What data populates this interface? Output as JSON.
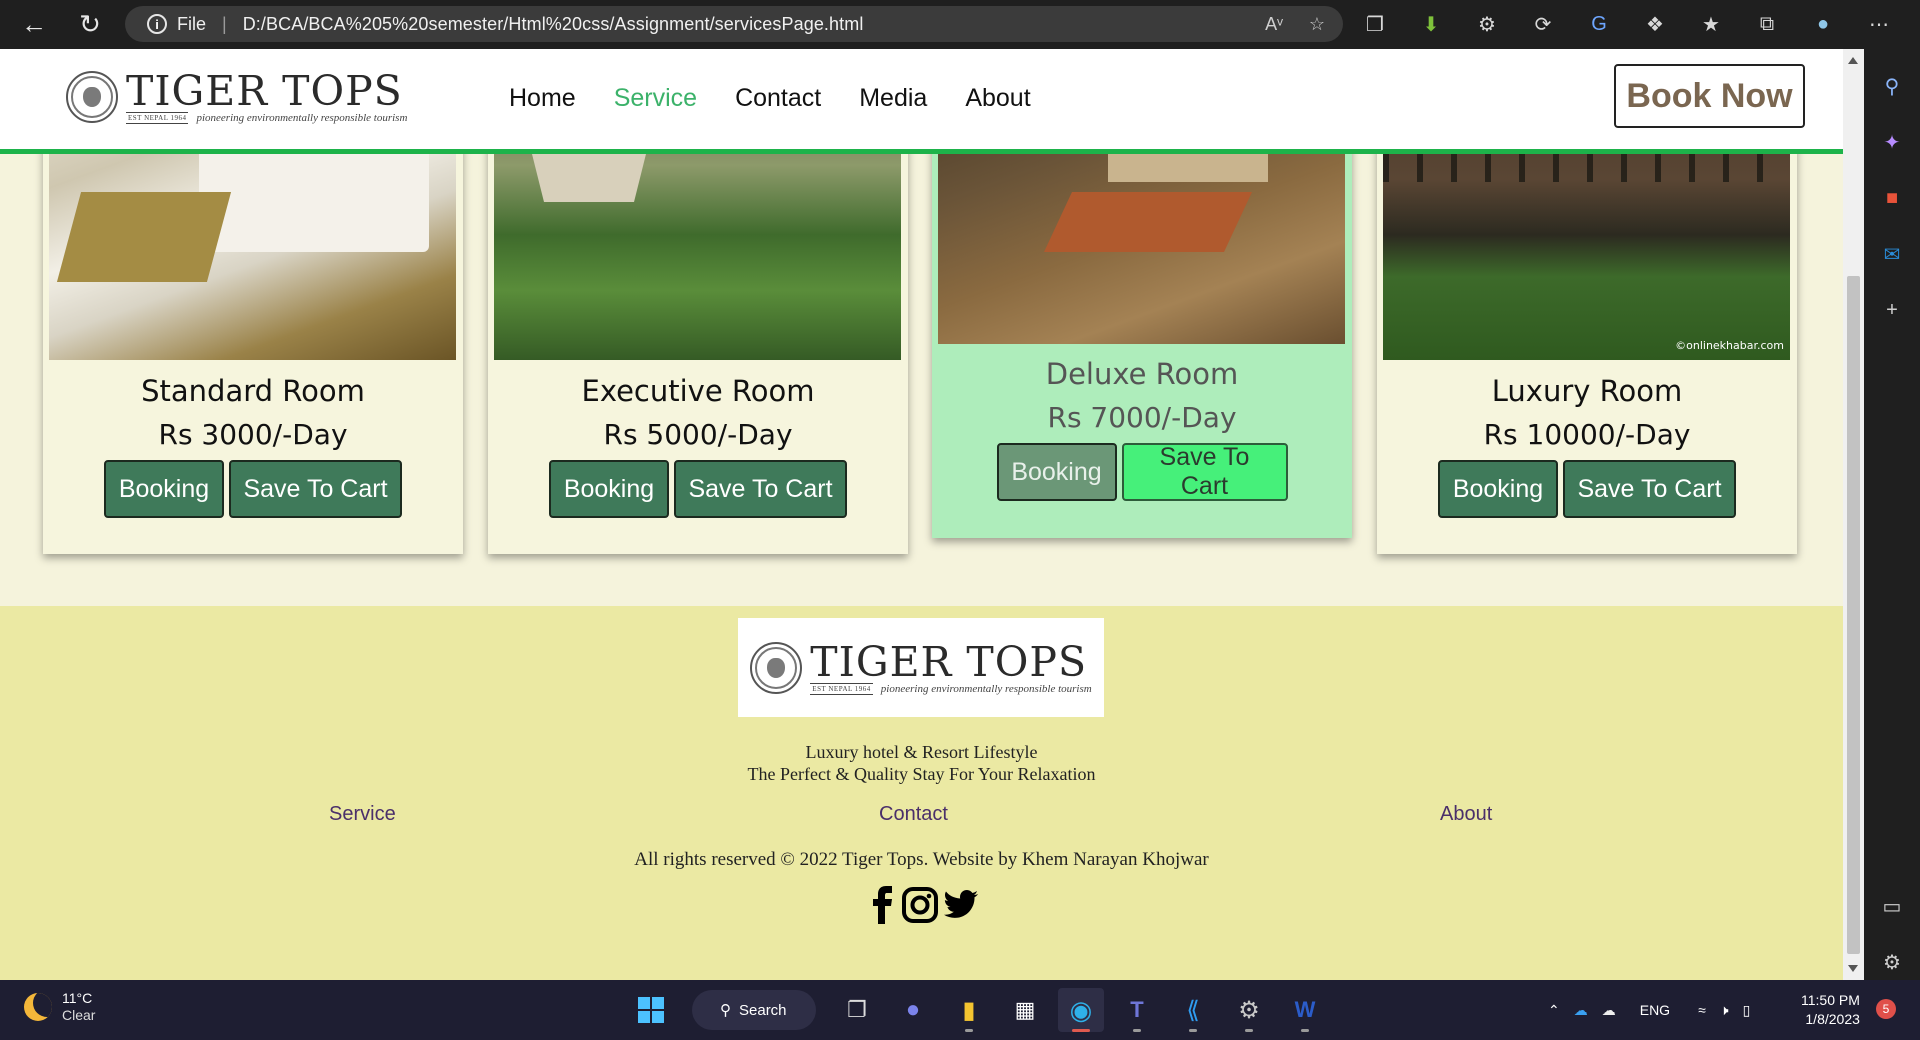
{
  "browser": {
    "url_label": "File",
    "url": "D:/BCA/BCA%205%20semester/Html%20css/Assignment/servicesPage.html"
  },
  "site": {
    "logo": {
      "title": "TIGER TOPS",
      "est": "EST NEPAL 1964",
      "tagline": "pioneering environmentally responsible tourism"
    },
    "nav": [
      "Home",
      "Service",
      "Contact",
      "Media",
      "About"
    ],
    "active_nav": "Service",
    "book_now": "Book Now",
    "accent_color": "#1db34a"
  },
  "rooms": [
    {
      "name": "Standard Room",
      "price": "Rs 3000/-Day",
      "booking": "Booking",
      "cart": "Save To Cart"
    },
    {
      "name": "Executive Room",
      "price": "Rs 5000/-Day",
      "booking": "Booking",
      "cart": "Save To Cart"
    },
    {
      "name": "Deluxe Room",
      "price": "Rs 7000/-Day",
      "booking": "Booking",
      "cart": "Save To Cart"
    },
    {
      "name": "Luxury Room",
      "price": "Rs 10000/-Day",
      "booking": "Booking",
      "cart": "Save To Cart",
      "watermark": "©onlinekhabar.com"
    }
  ],
  "footer": {
    "line1": "Luxury hotel & Resort Lifestyle",
    "line2": "The Perfect & Quality Stay For Your Relaxation",
    "links": [
      "Service",
      "Contact",
      "About"
    ],
    "copyright": "All rights reserved © 2022 Tiger Tops. Website by Khem Narayan Khojwar",
    "social": [
      "facebook-icon",
      "instagram-icon",
      "twitter-icon"
    ]
  },
  "taskbar": {
    "weather_temp": "11°C",
    "weather_desc": "Clear",
    "search_label": "Search",
    "language": "ENG",
    "time": "11:50 PM",
    "date": "1/8/2023",
    "notifications": "5"
  }
}
